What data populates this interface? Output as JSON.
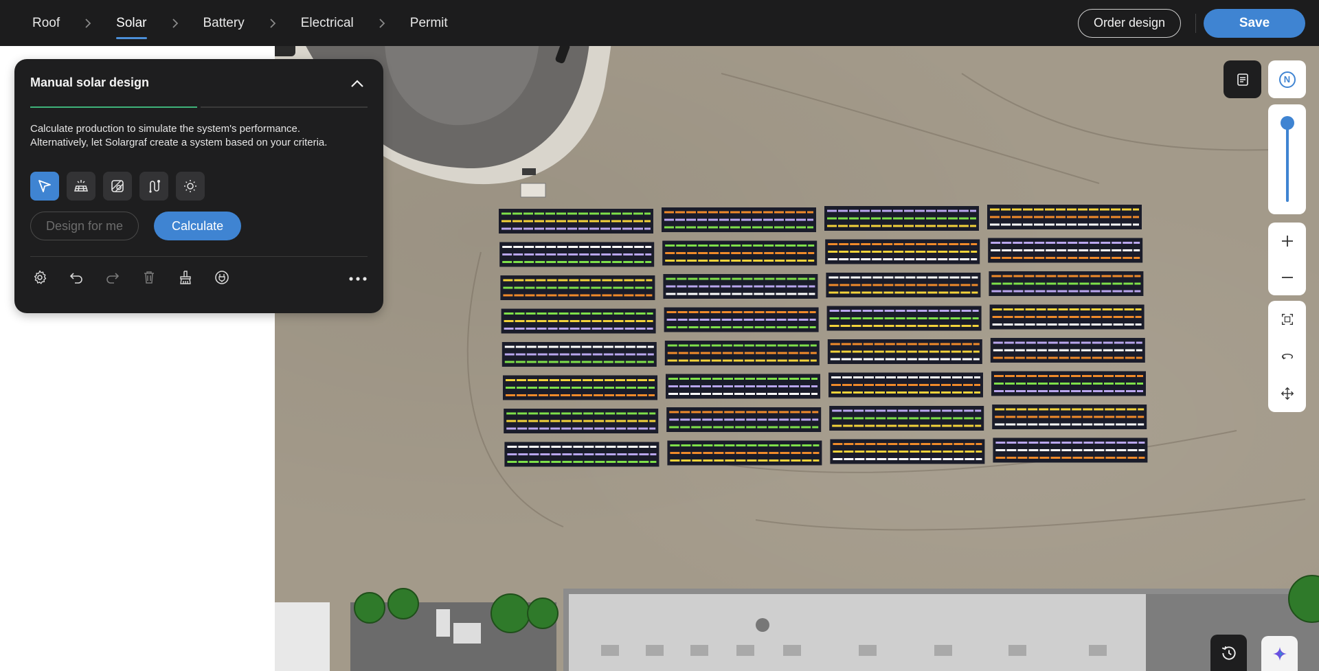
{
  "nav": {
    "steps": [
      {
        "label": "Roof",
        "active": false
      },
      {
        "label": "Solar",
        "active": true
      },
      {
        "label": "Battery",
        "active": false
      },
      {
        "label": "Electrical",
        "active": false
      },
      {
        "label": "Permit",
        "active": false
      }
    ],
    "order_design_label": "Order design",
    "save_label": "Save"
  },
  "panel": {
    "title": "Manual solar design",
    "progress": 0.5,
    "description_line1": "Calculate production to simulate the system's performance.",
    "description_line2": "Alternatively, let Solargraf create a system based on your criteria.",
    "tools": [
      {
        "icon": "select-pointer-icon",
        "active": true
      },
      {
        "icon": "panel-array-icon",
        "active": false
      },
      {
        "icon": "obstruction-icon",
        "active": false
      },
      {
        "icon": "string-wiring-icon",
        "active": false
      },
      {
        "icon": "shading-sun-icon",
        "active": false
      }
    ],
    "design_for_me_label": "Design for me",
    "calculate_label": "Calculate",
    "actions": [
      "settings-icon",
      "undo-icon",
      "redo-icon",
      "delete-icon",
      "clear-brush-icon",
      "power-icon"
    ],
    "more_icon": "more-horizontal-icon"
  },
  "map_controls": {
    "notes_icon": "notes-icon",
    "compass_label": "N",
    "zoom_in_icon": "plus-icon",
    "zoom_out_icon": "minus-icon",
    "view_icons": [
      "fit-view-icon",
      "rotate-view-icon",
      "pan-move-icon"
    ],
    "history_icon": "history-icon",
    "assistant_icon": "sparkle-icon"
  },
  "colors": {
    "accent": "#3f84d2",
    "topbar": "#1c1c1d",
    "panel": "#1e1e1f",
    "progress": "#3fb47a",
    "string_colors": [
      "#7ee04a",
      "#f2d23a",
      "#f08a2a",
      "#b9a6ee",
      "#ffffff"
    ]
  }
}
